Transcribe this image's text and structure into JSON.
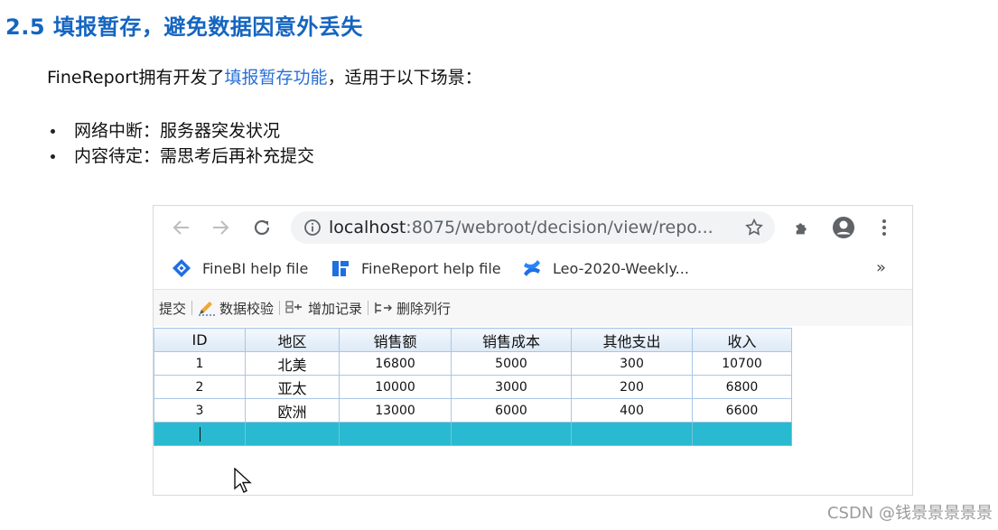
{
  "heading": "2.5 填报暂存，避免数据因意外丢失",
  "intro": {
    "prefix": "FineReport拥有开发了",
    "link": "填报暂存功能",
    "suffix": "，适用于以下场景："
  },
  "bullets": [
    "网络中断：服务器突发状况",
    "内容待定：需思考后再补充提交"
  ],
  "browser": {
    "url_host": "localhost",
    "url_rest": ":8075/webroot/decision/view/repo...",
    "bookmarks": [
      "FineBI help file",
      "FineReport help file",
      "Leo-2020-Weekly..."
    ],
    "bookmarks_more": "»"
  },
  "toolbar": {
    "submit": "提交",
    "validate": "数据校验",
    "add_record": "增加记录",
    "delete_row": "删除列行"
  },
  "table": {
    "headers": [
      "ID",
      "地区",
      "销售额",
      "销售成本",
      "其他支出",
      "收入"
    ],
    "rows": [
      [
        "1",
        "北美",
        "16800",
        "5000",
        "300",
        "10700"
      ],
      [
        "2",
        "亚太",
        "10000",
        "3000",
        "200",
        "6800"
      ],
      [
        "3",
        "欧洲",
        "13000",
        "6000",
        "400",
        "6600"
      ]
    ]
  },
  "watermark": "CSDN @钱景景景景景",
  "colors": {
    "heading": "#1565c0",
    "link": "#2a6fd6",
    "active_row": "#29b9d1"
  }
}
